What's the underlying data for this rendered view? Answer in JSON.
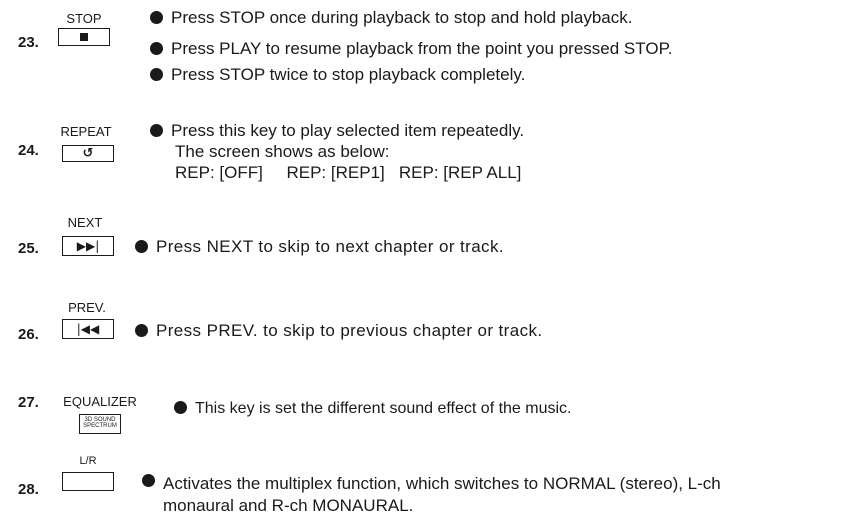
{
  "items": [
    {
      "number": "23.",
      "key": "STOP",
      "icon": "stop-icon",
      "lines": [
        "Press STOP once during playback to stop and hold playback.",
        "Press PLAY  to resume playback from the point you pressed STOP.",
        "Press STOP twice to stop playback completely."
      ]
    },
    {
      "number": "24.",
      "key": "REPEAT",
      "icon": "repeat-icon",
      "lines": [
        "Press this key to play selected item repeatedly.",
        "The screen shows as below:",
        "REP: [OFF]     REP: [REP1]   REP: [REP ALL]"
      ]
    },
    {
      "number": "25.",
      "key": "NEXT",
      "icon": "next-icon",
      "lines": [
        "Press NEXT to skip to next chapter or track."
      ]
    },
    {
      "number": "26.",
      "key": "PREV.",
      "icon": "previous-icon",
      "lines": [
        "Press PREV. to skip to previous chapter or track."
      ]
    },
    {
      "number": "27.",
      "key": "EQUALIZER",
      "key_caption": [
        "3D SOUND",
        "SPECTRUM"
      ],
      "lines": [
        "This key is set the different sound effect of the music."
      ]
    },
    {
      "number": "28.",
      "key": "L/R",
      "lines": [
        "Activates the multiplex function, which switches to NORMAL (stereo), L-ch",
        "monaural and R-ch MONAURAL."
      ]
    }
  ]
}
